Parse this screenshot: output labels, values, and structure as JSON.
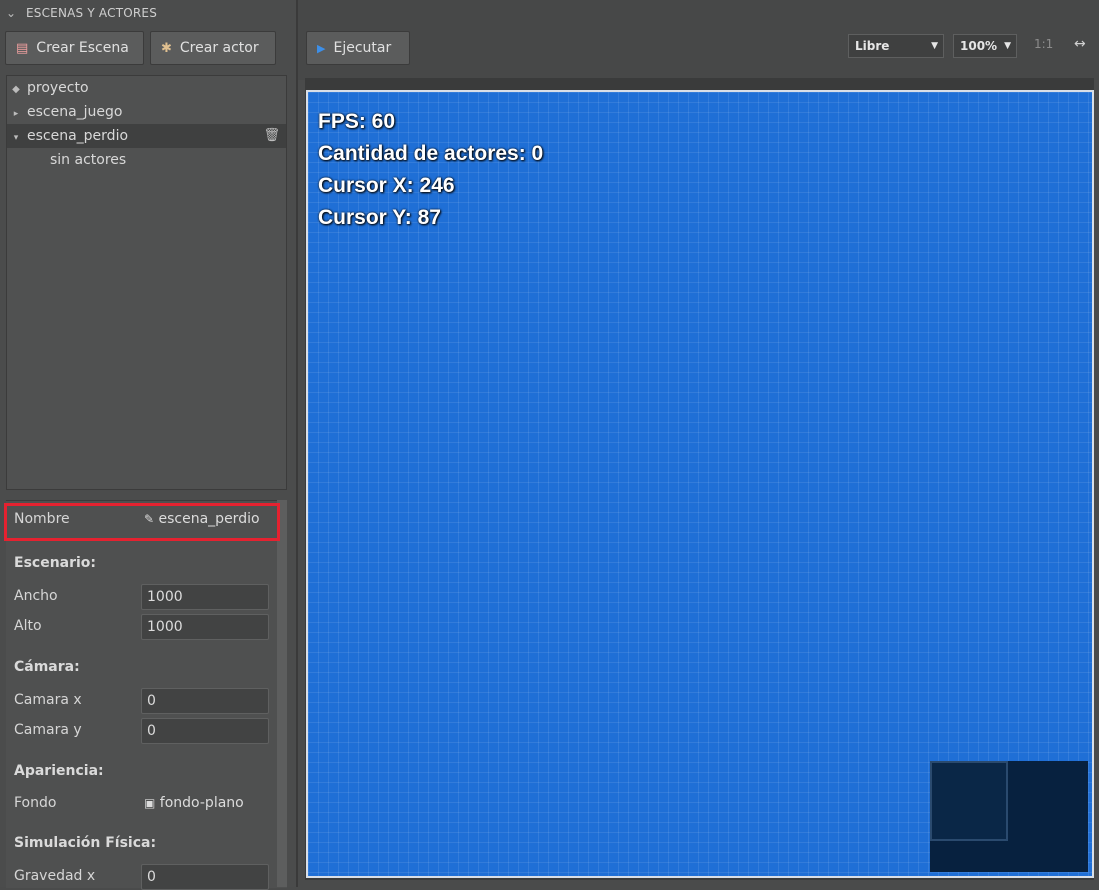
{
  "panel": {
    "section_title": "ESCENAS Y ACTORES",
    "buttons": {
      "create_scene": "Crear Escena",
      "create_actor": "Crear actor",
      "run": "Ejecutar"
    },
    "tree": {
      "root": "proyecto",
      "scenes": [
        {
          "label": "escena_juego",
          "expanded": false
        },
        {
          "label": "escena_perdio",
          "expanded": true,
          "selected": true
        }
      ],
      "empty_label": "sin actores"
    }
  },
  "toolbar": {
    "mode_select": "Libre",
    "zoom_select": "100%",
    "ratio_label": "1:1",
    "fit_label": "↔"
  },
  "properties": {
    "name_label": "Nombre",
    "name_value": "escena_perdio",
    "scenario_heading": "Escenario:",
    "width_label": "Ancho",
    "width_value": "1000",
    "height_label": "Alto",
    "height_value": "1000",
    "camera_heading": "Cámara:",
    "camera_x_label": "Camara x",
    "camera_x_value": "0",
    "camera_y_label": "Camara y",
    "camera_y_value": "0",
    "appearance_heading": "Apariencia:",
    "background_label": "Fondo",
    "background_value": "fondo-plano",
    "physics_heading": "Simulación Física:",
    "gravity_x_label": "Gravedad x",
    "gravity_x_value": "0"
  },
  "canvas": {
    "fps": "FPS: 60",
    "actor_count": "Cantidad de actores: 0",
    "cursor_x": "Cursor X: 246",
    "cursor_y": "Cursor Y: 87"
  },
  "colors": {
    "canvas_bg": "#1f6fd6",
    "highlight": "#e52230",
    "minimap": "#07213f"
  }
}
